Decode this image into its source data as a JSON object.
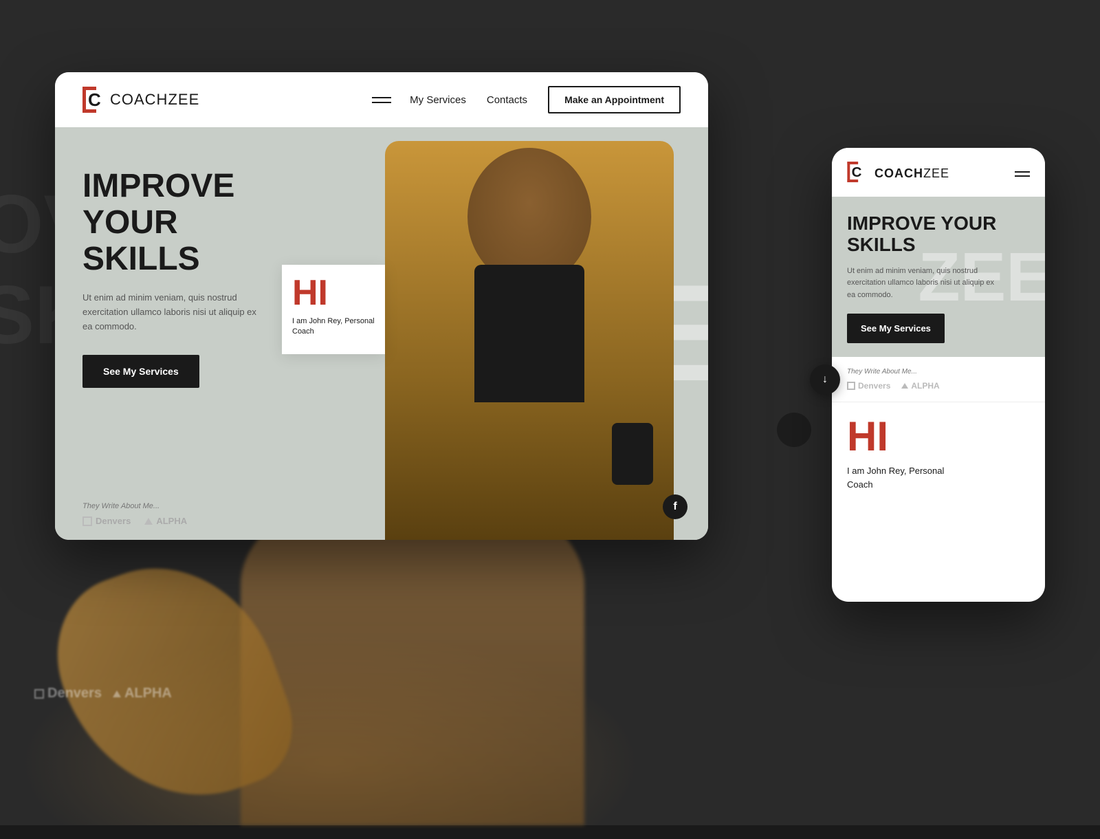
{
  "background": {
    "bg_improve_line1": "OVE",
    "bg_improve_line2": "SKI"
  },
  "desktop_card": {
    "nav": {
      "logo_brand": "COACH",
      "logo_suffix": "ZEE",
      "menu_link_1": "My Services",
      "menu_link_2": "Contacts",
      "cta_button": "Make an Appointment"
    },
    "hero": {
      "bg_letters": "ZEE",
      "title_line1": "IMPROVE",
      "title_line2": "YOUR SKILLS",
      "description": "Ut enim ad minim veniam, quis nostrud exercitation ullamco laboris nisi ut aliquip ex ea commodo.",
      "cta_button": "See My Services",
      "they_write": "They Write About Me...",
      "brand1": "Denvers",
      "brand2": "ALPHA",
      "hi_text": "HI",
      "hi_subtitle": "I am John Rey, Personal Coach"
    }
  },
  "mobile_card": {
    "nav": {
      "logo_brand": "COACH",
      "logo_suffix": "ZEE"
    },
    "hero": {
      "bg_letters": "ZEE",
      "title_line1": "IMPROVE YOUR",
      "title_line2": "SKILLS",
      "description": "Ut enim ad minim veniam, quis nostrud exercitation ullamco laboris nisi ut aliquip ex ea commodo.",
      "cta_button": "See My Services",
      "they_write": "They Write About Me...",
      "brand1": "Denvers",
      "brand2": "ALPHA"
    },
    "hi_section": {
      "hi_text": "HI",
      "hi_subtitle_line1": "I am John Rey, Personal",
      "hi_subtitle_line2": "Coach"
    }
  }
}
